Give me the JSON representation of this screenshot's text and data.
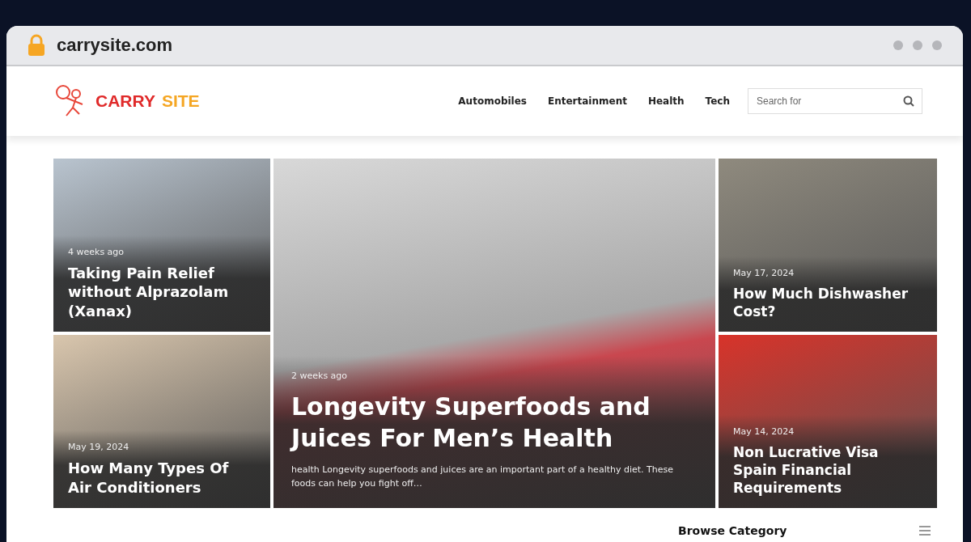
{
  "browser": {
    "address": "carrysite.com"
  },
  "site": {
    "logo_primary": "CARRY",
    "logo_secondary": "SITE"
  },
  "nav": [
    {
      "label": "Automobiles"
    },
    {
      "label": "Entertainment"
    },
    {
      "label": "Health"
    },
    {
      "label": "Tech"
    }
  ],
  "search": {
    "placeholder": "Search for"
  },
  "featured": {
    "date": "2 weeks ago",
    "title": "Longevity Superfoods and Juices For Men’s Health",
    "excerpt": "health Longevity superfoods and juices are an important part of a healthy diet. These foods can help you fight off…"
  },
  "left_posts": [
    {
      "date": "4 weeks ago",
      "title": "Taking Pain Relief without Alprazolam (Xanax)"
    },
    {
      "date": "May 19, 2024",
      "title": "How Many Types Of Air Conditioners"
    }
  ],
  "right_posts": [
    {
      "date": "May 17, 2024",
      "title": "How Much Dishwasher Cost?"
    },
    {
      "date": "May 14, 2024",
      "title": "Non Lucrative Visa Spain Financial Requirements"
    }
  ],
  "sidebar": {
    "heading": "Browse Category"
  }
}
